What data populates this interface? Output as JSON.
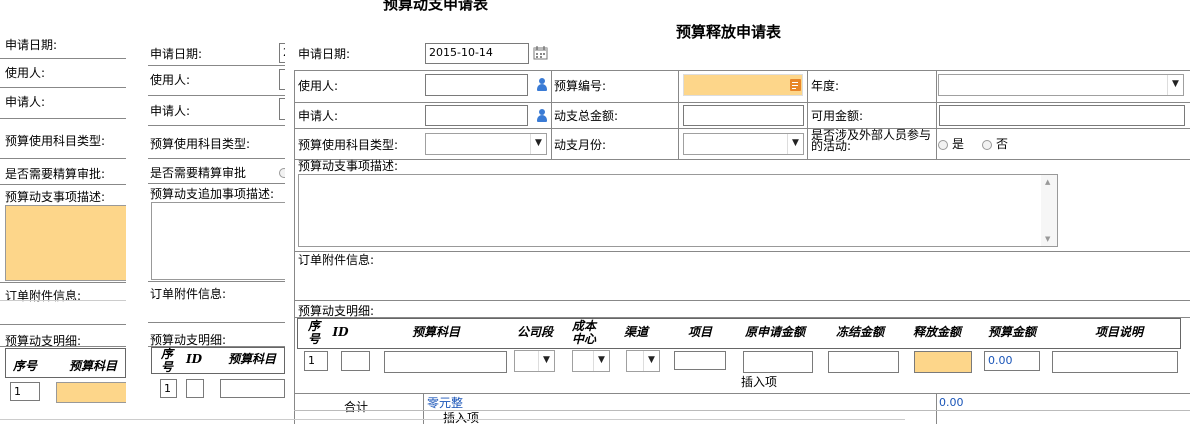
{
  "bg_title": "预算动支申请表",
  "left": {
    "apply_date_label": "申请日期:",
    "user_label": "使用人:",
    "applicant_label": "申请人:",
    "subject_type_label": "预算使用科目类型:",
    "need_audit_label": "是否需要精算审批:",
    "desc_label": "预算动支事项描述:",
    "attach_label": "订单附件信息:",
    "detail_label": "预算动支明细:",
    "col_seq": "序号",
    "col_subject": "预算科目",
    "row_seq": "1"
  },
  "mid": {
    "apply_date_label": "申请日期:",
    "apply_date_value": "2",
    "user_label": "使用人:",
    "applicant_label": "申请人:",
    "subject_type_label": "预算使用科目类型:",
    "need_audit_label": "是否需要精算审批",
    "desc_label": "预算动支追加事项描述:",
    "attach_label": "订单附件信息:",
    "detail_label": "预算动支明细:",
    "col_seq": "序号",
    "col_id": "ID",
    "col_subject": "预算科目",
    "row_seq": "1"
  },
  "main": {
    "title": "预算释放申请表",
    "apply_date_label": "申请日期:",
    "apply_date_value": "2015-10-14",
    "user_label": "使用人:",
    "budget_no_label": "预算编号:",
    "year_label": "年度:",
    "applicant_label": "申请人:",
    "total_amount_label": "动支总金额:",
    "available_label": "可用金额:",
    "subject_type_label": "预算使用科目类型:",
    "month_label": "动支月份:",
    "external_label": "是否涉及外部人员参与的活动:",
    "yes_label": "是",
    "no_label": "否",
    "desc_label": "预算动支事项描述:",
    "attach_label": "订单附件信息:",
    "detail_label": "预算动支明细:",
    "columns": [
      "序号",
      "ID",
      "预算科目",
      "公司段",
      "成本中心",
      "渠道",
      "项目",
      "原申请金额",
      "冻结金额",
      "释放金额",
      "预算金额",
      "项目说明"
    ],
    "row": {
      "seq": "1",
      "budget_amount": "0.00"
    },
    "insert_item": "插入项",
    "total_label": "合计",
    "total_words": "零元整",
    "total_value": "0.00",
    "bottom_insert": "插入项"
  }
}
